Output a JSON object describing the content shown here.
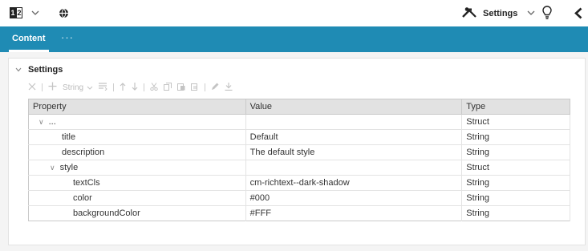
{
  "topbar": {
    "logo_digit_1": "1",
    "logo_digit_2": "2",
    "settings_label": "Settings"
  },
  "tabs": {
    "active_label": "Content",
    "more_label": "···"
  },
  "panel": {
    "title": "Settings",
    "toolbar": {
      "type_select_value": "String"
    },
    "columns": [
      "Property",
      "Value",
      "Type"
    ],
    "rows": [
      {
        "property": "...",
        "value": "",
        "type": "Struct",
        "level": 0,
        "expanded": true
      },
      {
        "property": "title",
        "value": "Default",
        "type": "String",
        "level": 1,
        "expanded": null
      },
      {
        "property": "description",
        "value": "The default style",
        "type": "String",
        "level": 1,
        "expanded": null
      },
      {
        "property": "style",
        "value": "",
        "type": "Struct",
        "level": 1,
        "expanded": true
      },
      {
        "property": "textCls",
        "value": "cm-richtext--dark-shadow",
        "type": "String",
        "level": 2,
        "expanded": null
      },
      {
        "property": "color",
        "value": "#000",
        "type": "String",
        "level": 2,
        "expanded": null
      },
      {
        "property": "backgroundColor",
        "value": "#FFF",
        "type": "String",
        "level": 2,
        "expanded": null
      }
    ]
  },
  "colors": {
    "tab_bar": "#1f8bb4",
    "header_row": "#e2e2e2",
    "toolbar_disabled": "#bcbcbc"
  }
}
